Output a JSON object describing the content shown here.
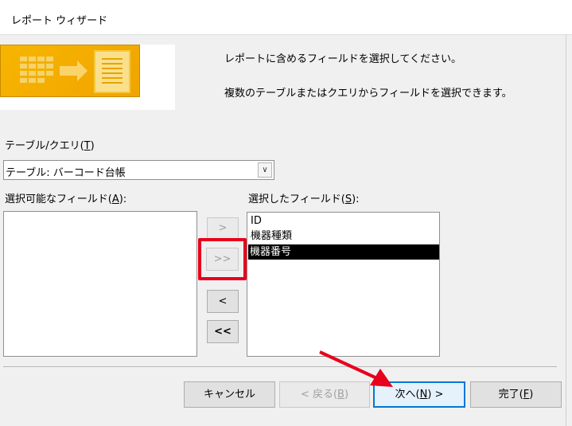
{
  "window": {
    "title": "レポート ウィザード"
  },
  "instructions": {
    "line1": "レポートに含めるフィールドを選択してください。",
    "line2": "複数のテーブルまたはクエリからフィールドを選択できます。"
  },
  "table_query": {
    "label_prefix": "テーブル/クエリ(",
    "label_key": "T",
    "label_suffix": ")",
    "selected_value": "テーブル: バーコード台帳",
    "dropdown_icon": "chevron-down-icon"
  },
  "available_fields": {
    "label_prefix": "選択可能なフィールド(",
    "label_key": "A",
    "label_suffix": "):",
    "items": []
  },
  "selected_fields": {
    "label_prefix": "選択したフィールド(",
    "label_key": "S",
    "label_suffix": "):",
    "items": [
      "ID",
      "機器種類",
      "機器番号"
    ],
    "highlighted_item": "機器番号"
  },
  "move_buttons": {
    "add_one": ">",
    "add_all": ">>",
    "remove_one": "<",
    "remove_all": "<<"
  },
  "footer": {
    "cancel": "キャンセル",
    "back_prefix": "< 戻る(",
    "back_key": "B",
    "back_suffix": ")",
    "next_prefix": "次へ(",
    "next_key": "N",
    "next_suffix": ") >",
    "finish_prefix": "完了(",
    "finish_key": "F",
    "finish_suffix": ")"
  },
  "annotations": {
    "highlight_color": "#e8001c",
    "arrow_color": "#e8001c"
  }
}
